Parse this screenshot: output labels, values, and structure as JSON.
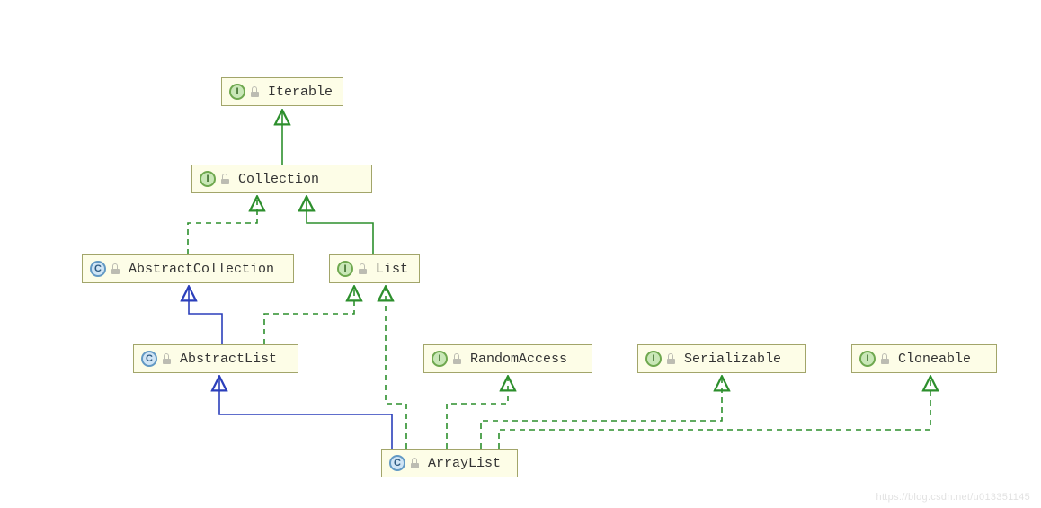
{
  "nodes": {
    "iterable": {
      "label": "Iterable",
      "kind": "interface"
    },
    "collection": {
      "label": "Collection",
      "kind": "interface"
    },
    "abstractCollection": {
      "label": "AbstractCollection",
      "kind": "class"
    },
    "list": {
      "label": "List",
      "kind": "interface"
    },
    "abstractList": {
      "label": "AbstractList",
      "kind": "class"
    },
    "randomAccess": {
      "label": "RandomAccess",
      "kind": "interface"
    },
    "serializable": {
      "label": "Serializable",
      "kind": "interface"
    },
    "cloneable": {
      "label": "Cloneable",
      "kind": "interface"
    },
    "arrayList": {
      "label": "ArrayList",
      "kind": "class"
    }
  },
  "watermark": "https://blog.csdn.net/u013351145"
}
